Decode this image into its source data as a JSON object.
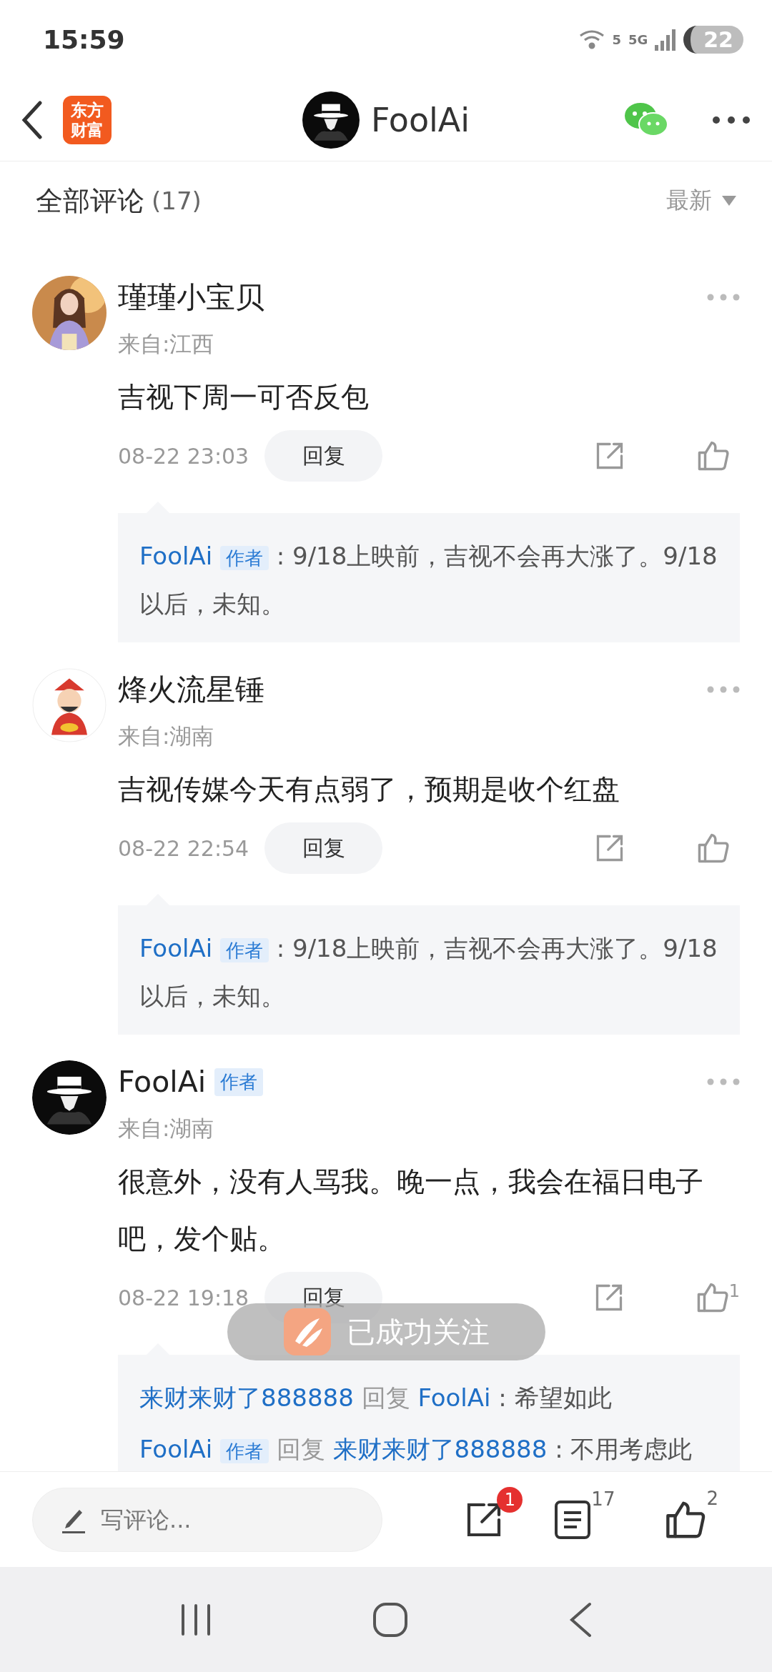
{
  "status_bar": {
    "time": "15:59",
    "wifi_label": "5",
    "network": "5G",
    "battery": "22"
  },
  "header": {
    "logo_lines": [
      "东方",
      "财富"
    ],
    "title": "FoolAi"
  },
  "comments_header": {
    "title": "全部评论",
    "count": "(17)",
    "sort": "最新"
  },
  "comments": [
    {
      "name": "瑾瑾小宝贝",
      "is_author": false,
      "location": "来自:江西",
      "content": "吉视下周一可否反包",
      "time": "08-22 23:03",
      "reply_button": "回复",
      "replies": [
        {
          "author": "FoolAi",
          "author_badge": "作者",
          "text": ": 9/18上映前，吉视不会再大涨了。9/18以后，未知。"
        }
      ]
    },
    {
      "name": "烽火流星锤",
      "is_author": false,
      "location": "来自:湖南",
      "content": "吉视传媒今天有点弱了，预期是收个红盘",
      "time": "08-22 22:54",
      "reply_button": "回复",
      "replies": [
        {
          "author": "FoolAi",
          "author_badge": "作者",
          "text": ": 9/18上映前，吉视不会再大涨了。9/18以后，未知。"
        }
      ]
    },
    {
      "name": "FoolAi",
      "is_author": true,
      "author_badge": "作者",
      "location": "来自:湖南",
      "content": "很意外，没有人骂我。晚一点，我会在福日电子吧，发个贴。",
      "time": "08-22 19:18",
      "reply_button": "回复",
      "likes": "1",
      "replies": [
        {
          "author": "来财来财了888888",
          "reply_word": "回复",
          "reply_to": "FoolAi",
          "text": ": 希望如此"
        },
        {
          "author": "FoolAi",
          "author_badge": "作者",
          "reply_word": "回复",
          "reply_to": "来财来财了888888",
          "text": ": 不用考虑此"
        }
      ]
    }
  ],
  "toast": {
    "text": "已成功关注"
  },
  "bottom_bar": {
    "placeholder": "写评论...",
    "share_badge": "1",
    "comment_count": "17",
    "like_count": "2"
  }
}
